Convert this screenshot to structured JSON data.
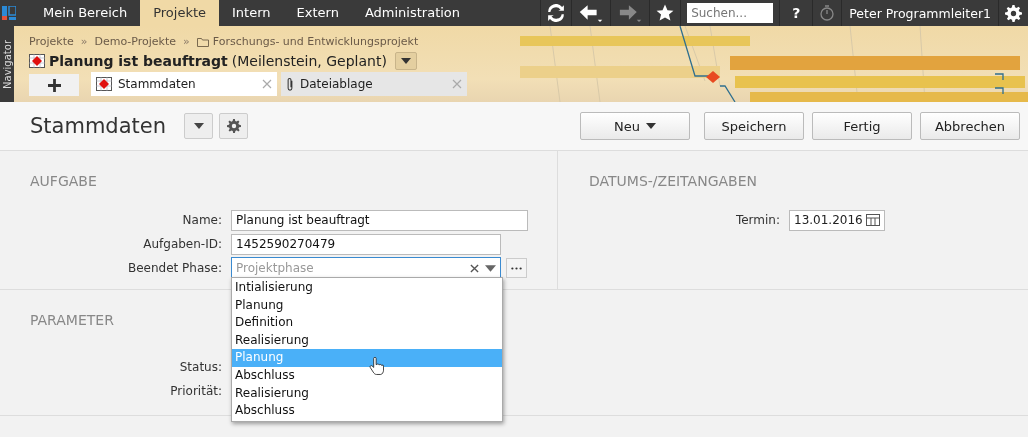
{
  "menu": [
    {
      "label": "Mein Bereich",
      "selected": false
    },
    {
      "label": "Projekte",
      "selected": true
    },
    {
      "label": "Intern",
      "selected": false
    },
    {
      "label": "Extern",
      "selected": false
    },
    {
      "label": "Administration",
      "selected": false
    }
  ],
  "search": {
    "placeholder": "Suchen..."
  },
  "help": "?",
  "user": "Peter Programmleiter1",
  "navigator": "Navigator",
  "breadcrumb": [
    {
      "label": "Projekte",
      "kind": "link"
    },
    {
      "label": "Demo-Projekte",
      "kind": "link"
    },
    {
      "label": "Forschungs- und Entwicklungsprojekt",
      "kind": "folder"
    }
  ],
  "breadcrumb_separator": "»",
  "title": {
    "name": "Planung ist beauftragt",
    "meta": "(Meilenstein, Geplant)"
  },
  "tabs": [
    {
      "label": "Stammdaten",
      "kind": "milestone",
      "selected": true
    },
    {
      "label": "Dateiablage",
      "kind": "attachment",
      "selected": false
    }
  ],
  "page_title": "Stammdaten",
  "buttons": [
    {
      "label": "Neu",
      "kind": "menu"
    },
    {
      "label": "Speichern",
      "kind": "plain"
    },
    {
      "label": "Fertig",
      "kind": "plain"
    },
    {
      "label": "Abbrechen",
      "kind": "plain"
    }
  ],
  "sections": [
    {
      "heading": "AUFGABE",
      "fields": [
        {
          "label": "Name:",
          "kind": "text",
          "value": "Planung ist beauftragt"
        },
        {
          "label": "Aufgaben-ID:",
          "kind": "text",
          "value": "1452590270479"
        },
        {
          "label": "Beendet Phase:",
          "kind": "combo",
          "placeholder": "Projektphase"
        }
      ]
    },
    {
      "heading": "DATUMS-/ZEITANGABEN",
      "fields": [
        {
          "label": "Termin:",
          "kind": "date",
          "value": "13.01.2016"
        }
      ]
    },
    {
      "heading": "PARAMETER",
      "fields": [
        {
          "label": "Status:"
        },
        {
          "label": "Priorität:"
        }
      ]
    }
  ],
  "dropdown": {
    "options": [
      {
        "label": "Intialisierung",
        "selected": false
      },
      {
        "label": "Planung",
        "selected": false
      },
      {
        "label": "Definition",
        "selected": false
      },
      {
        "label": "Realisierung",
        "selected": false
      },
      {
        "label": "Planung",
        "selected": true
      },
      {
        "label": "Abschluss",
        "selected": false
      },
      {
        "label": "Realisierung",
        "selected": false
      },
      {
        "label": "Abschluss",
        "selected": false
      }
    ]
  }
}
